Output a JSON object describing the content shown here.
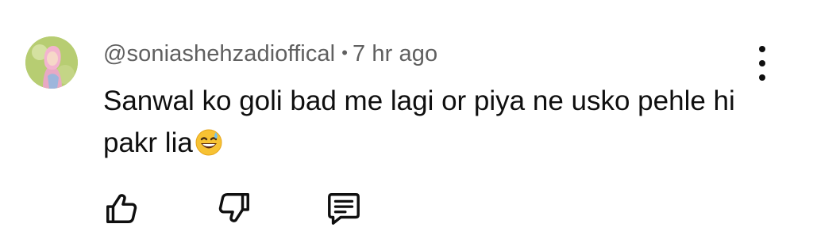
{
  "comment": {
    "author": "@soniashehzadioffical",
    "separator": "•",
    "time": "7 hr ago",
    "text": "Sanwal ko goli bad me lagi or piya ne usko pehle hi pakr lia",
    "emoji": "grinning-face-with-sweat"
  },
  "icons": {
    "avatar": "avatar-image",
    "more": "more-vertical-icon",
    "like": "thumbs-up-icon",
    "dislike": "thumbs-down-icon",
    "reply": "reply-comment-icon"
  },
  "colors": {
    "text": "#0f0f0f",
    "meta": "#606060",
    "background": "#ffffff"
  }
}
